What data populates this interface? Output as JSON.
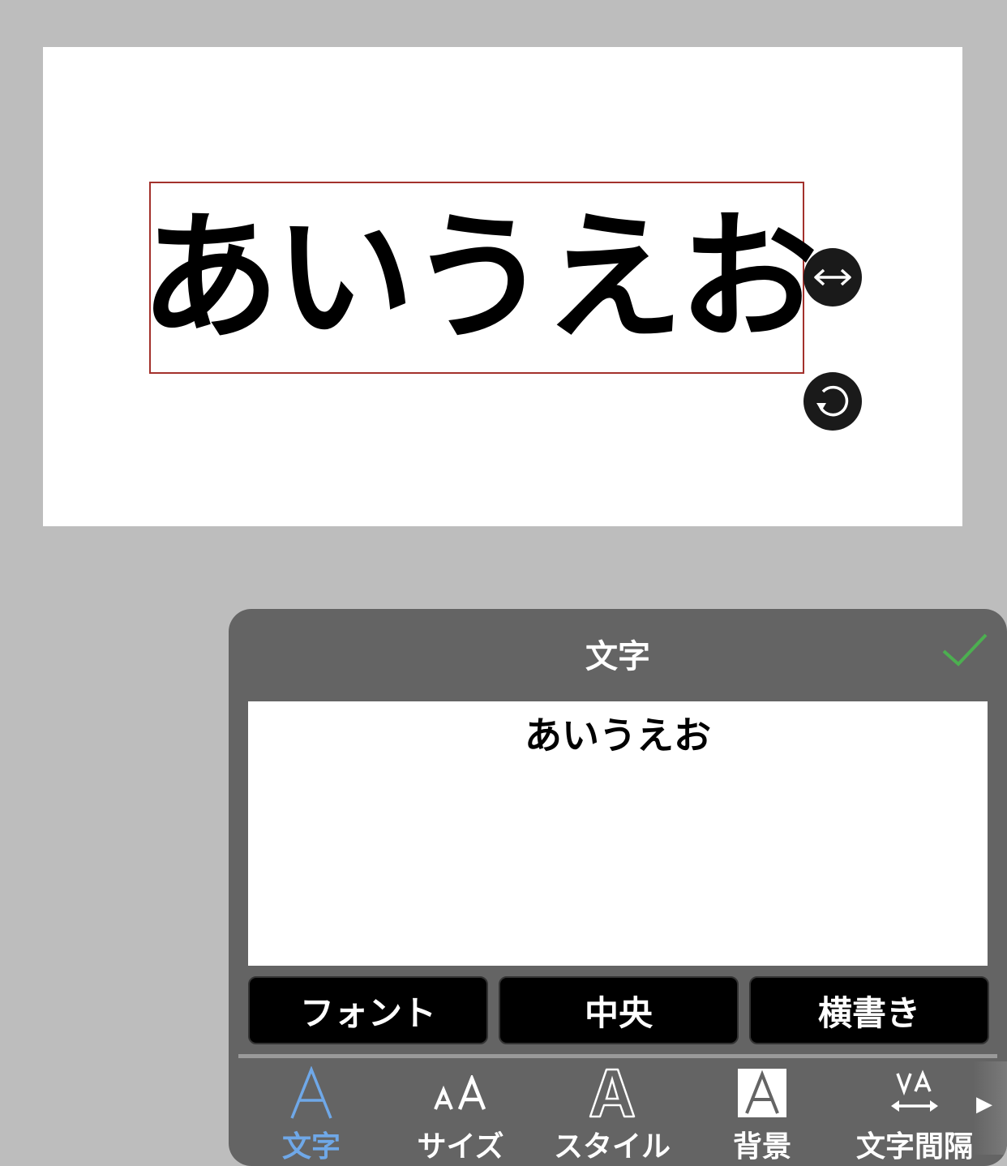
{
  "canvas": {
    "text": "あいうえお",
    "icons": {
      "resize": "horizontal-arrows-icon",
      "rotate": "rotate-icon"
    }
  },
  "panel": {
    "title": "文字",
    "confirm_icon": "checkmark-icon",
    "editor_value": "あいうえお",
    "buttons": {
      "font": "フォント",
      "align": "中央",
      "direction": "横書き"
    },
    "tabs": [
      {
        "label": "文字",
        "icon": "text-a-icon",
        "active": true
      },
      {
        "label": "サイズ",
        "icon": "text-size-icon",
        "active": false
      },
      {
        "label": "スタイル",
        "icon": "text-outline-icon",
        "active": false
      },
      {
        "label": "背景",
        "icon": "text-background-icon",
        "active": false
      },
      {
        "label": "文字間隔",
        "icon": "letter-spacing-icon",
        "active": false
      }
    ],
    "more_icon": "chevron-right-icon"
  },
  "colors": {
    "accent": "#6fa8e8",
    "confirm": "#4caf50",
    "selection_border": "#a3312c",
    "panel_bg": "#646464",
    "page_bg": "#bdbdbd"
  }
}
